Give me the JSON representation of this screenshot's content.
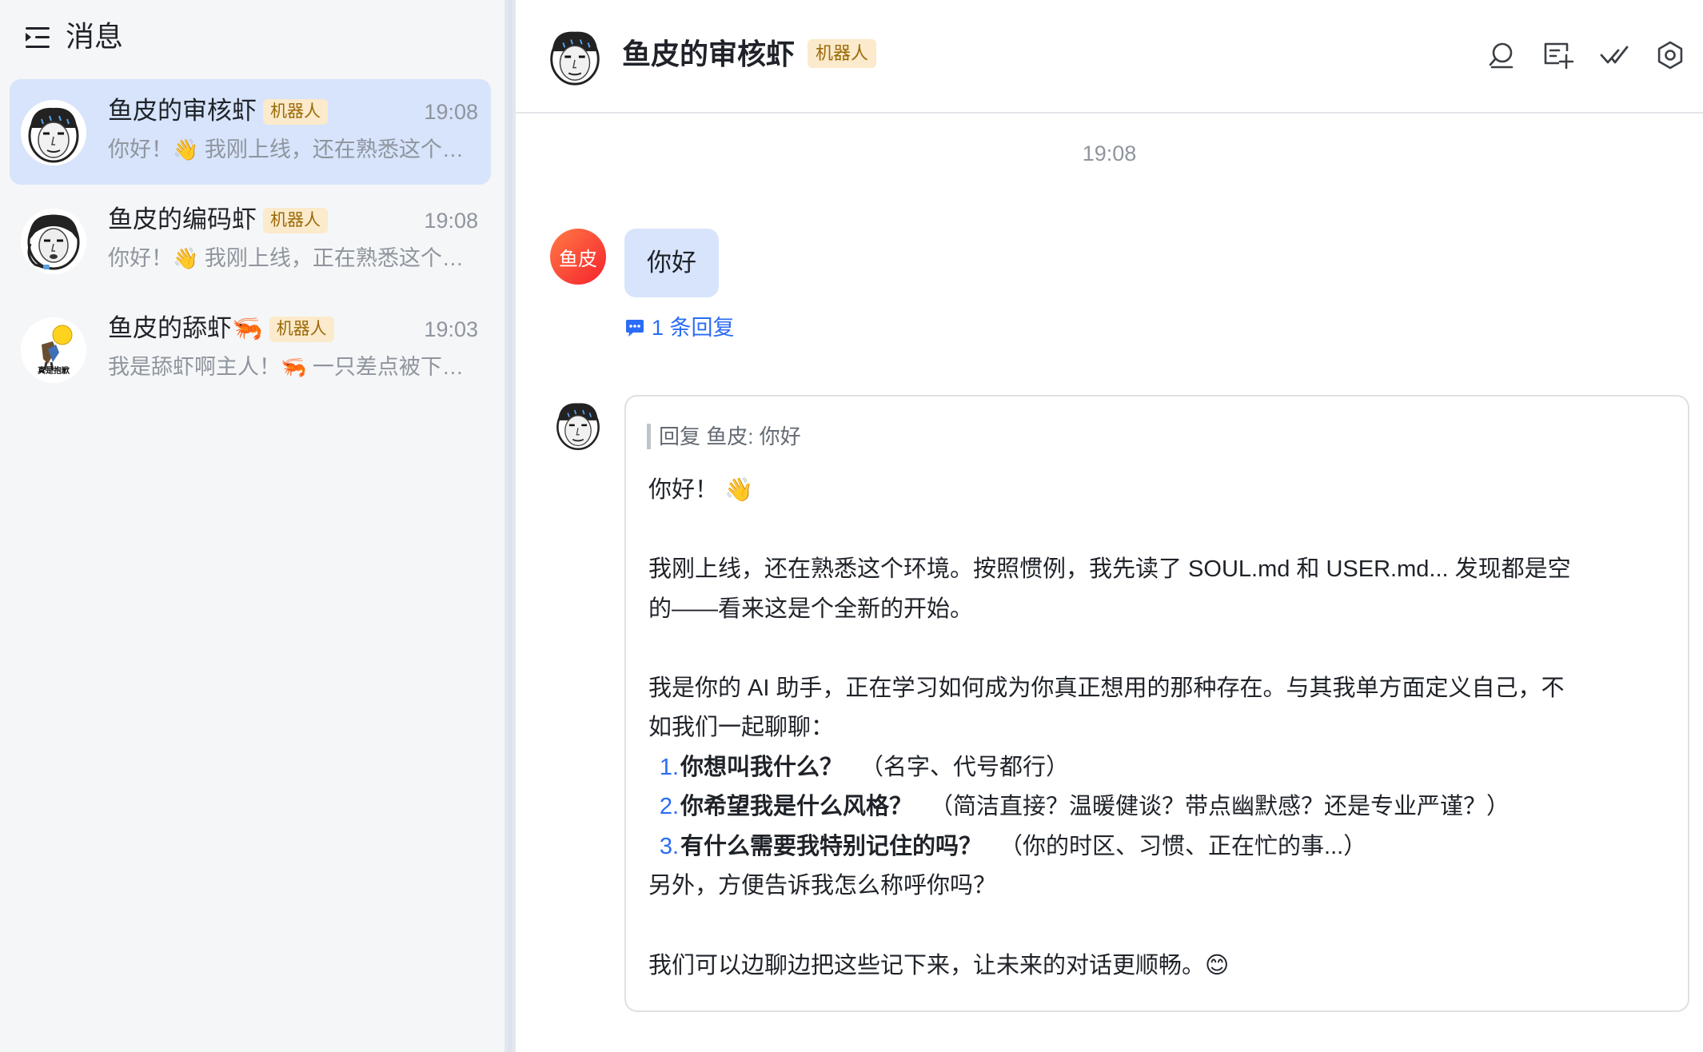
{
  "sidebar": {
    "title": "消息",
    "conversations": [
      {
        "name": "鱼皮的审核虾",
        "badge": "机器人",
        "time": "19:08",
        "preview_pre": "你好！",
        "preview_emoji": "👋",
        "preview_post": " 我刚上线，还在熟悉这个环境...",
        "active": true
      },
      {
        "name": "鱼皮的编码虾",
        "badge": "机器人",
        "time": "19:08",
        "preview_pre": "你好！",
        "preview_emoji": "👋",
        "preview_post": " 我刚上线，正在熟悉这个环境...",
        "active": false
      },
      {
        "name": "鱼皮的舔虾",
        "name_emoji": "🦐",
        "badge": "机器人",
        "time": "19:03",
        "preview_pre": "我是舔虾啊主人！",
        "preview_emoji": "🦐",
        "preview_post": " 一只差点被下锅的虾...",
        "active": false
      }
    ],
    "avatar3_caption": "真是抱歉"
  },
  "chat": {
    "title": "鱼皮的审核虾",
    "badge": "机器人",
    "header_icons": [
      "search-icon",
      "add-screen-icon",
      "done-check-icon",
      "settings-icon"
    ],
    "timestamp": "19:08",
    "user": {
      "avatar_text": "鱼皮",
      "message": "你好",
      "reply_count_label": "1 条回复"
    },
    "bot": {
      "quote": "回复 鱼皮: 你好",
      "greeting": "你好！",
      "greeting_emoji": "👋",
      "p1": "我刚上线，还在熟悉这个环境。按照惯例，我先读了 SOUL.md 和 USER.md... 发现都是空",
      "p1b": "的——看来这是个全新的开始。",
      "p2": "我是你的 AI 助手，正在学习如何成为你真正想用的那种存在。与其我单方面定义自己，不",
      "p2b": "如我们一起聊聊：",
      "list": [
        {
          "num": "1.",
          "q": "你想叫我什么？",
          "hint": "（名字、代号都行）"
        },
        {
          "num": "2.",
          "q": "你希望我是什么风格？",
          "hint": "（简洁直接？温暖健谈？带点幽默感？还是专业严谨？）"
        },
        {
          "num": "3.",
          "q": "有什么需要我特别记住的吗？",
          "hint": "（你的时区、习惯、正在忙的事...）"
        }
      ],
      "p3": "另外，方便告诉我怎么称呼你吗？",
      "p4": "我们可以边聊边把这些记下来，让未来的对话更顺畅。",
      "p4_emoji": "😊"
    }
  },
  "colors": {
    "accent": "#2b6cf6",
    "active_item": "#d7e4fb",
    "badge_bg": "#fbeacb",
    "badge_text": "#9b6a08",
    "user_avatar": "#f5222d"
  }
}
